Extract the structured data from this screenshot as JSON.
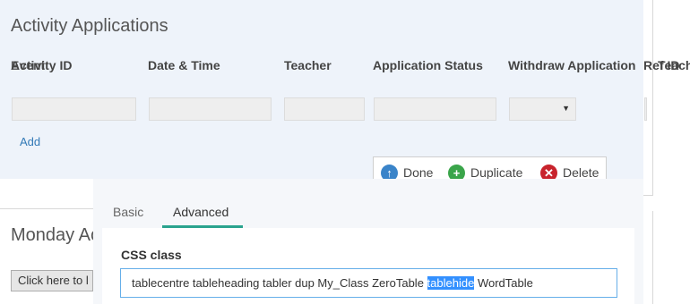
{
  "activity": {
    "title": "Activity Applications",
    "columns": {
      "activity_id": "Activity ID",
      "event": "Event",
      "date_time": "Date & Time",
      "teacher": "Teacher",
      "application_status": "Application Status",
      "withdraw_application": "Withdraw Application",
      "ref_id": "Ref ID",
      "teacher_overlap": "Teacher"
    },
    "add_label": "Add"
  },
  "toolbar": {
    "done_label": "Done",
    "duplicate_label": "Duplicate",
    "delete_label": "Delete",
    "colors": {
      "done": "#3a84c9",
      "duplicate": "#3aa54a",
      "delete": "#c8232c"
    }
  },
  "props": {
    "tabs": [
      "Basic",
      "Advanced"
    ],
    "active_tab": "Advanced",
    "css_label": "CSS class",
    "css_value_before": "tablecentre tableheading tabler dup My_Class ZeroTable ",
    "css_value_selected": "tablehide",
    "css_value_after": " WordTable",
    "accent": "#2aa38e"
  },
  "monday": {
    "title": "Monday Ac",
    "button_label": "Click here to l"
  }
}
